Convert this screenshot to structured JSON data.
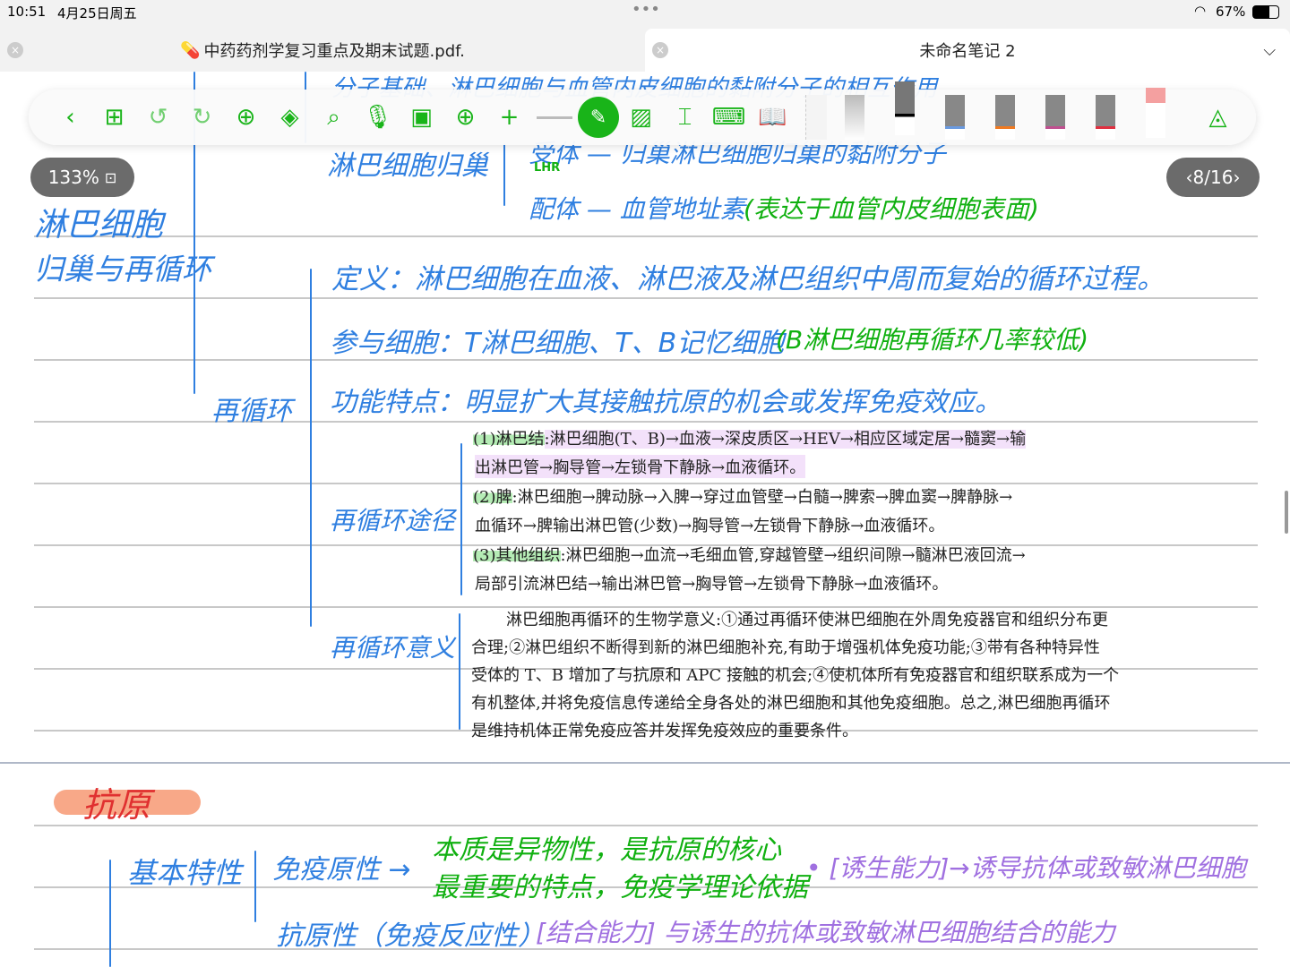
{
  "status": {
    "time": "10:51",
    "date": "4月25日周五",
    "battery": "67%"
  },
  "tabs": [
    {
      "title": "中药药剂学复习重点及期末试题.pdf.",
      "active": false
    },
    {
      "title": "未命名笔记 2",
      "active": true
    }
  ],
  "toolbar": {
    "icons": [
      "back-icon",
      "grid-icon",
      "undo-icon",
      "redo-icon",
      "add-page-icon",
      "layers-icon",
      "search-icon",
      "microphone-icon",
      "media-icon",
      "globe-icon",
      "plus-icon",
      "pen-icon",
      "image-icon",
      "text-box-icon",
      "keyboard-icon",
      "book-icon"
    ],
    "active_color": "#19b419"
  },
  "zoom": "133%",
  "page_indicator": "8/16",
  "notes": {
    "top_cut": "分子基础、淋巴细胞与血管内皮细胞的黏附分子的相互作用",
    "homing": "淋巴细胞归巢",
    "receptor": "受体 — 归巢淋巴细胞归巢的黏附分子",
    "lhr": "LHR",
    "ligand": "配体 — 血管地址素",
    "ligand_note": "(表达于血管内皮细胞表面)",
    "main_title_1": "淋巴细胞",
    "main_title_2": "归巢与再循环",
    "recirc": "再循环",
    "definition": "定义：淋巴细胞在血液、淋巴液及淋巴组织中周而复始的循环过程。",
    "cells": "参与细胞：T淋巴细胞、T、B记忆细胞",
    "cells_note": "(B淋巴细胞再循环几率较低)",
    "function": "功能特点：明显扩大其接触抗原的机会或发挥免疫效应。",
    "pathway": "再循环途径",
    "significance": "再循环意义",
    "antigen": "抗原",
    "basic": "基本特性",
    "immunogenicity": "免疫原性 →",
    "imm_note1": "本质是异物性，是抗原的核心",
    "imm_note2": "最重要的特点，免疫学理论依据",
    "induce": "• [诱生能力]→诱导抗体或致敏淋巴细胞",
    "antigenicity": "抗原性（免疫反应性）",
    "binding": "[结合能力] 与诱生的抗体或致敏淋巴细胞结合的能力"
  },
  "printed": {
    "p1a": "(1)淋巴结",
    "p1b": ":淋巴细胞(T、B)→血液→深皮质区→HEV→相应区域定居→髓窦→输",
    "p1c": "出淋巴管→胸导管→左锁骨下静脉→血液循环。",
    "p2a": "(2)脾",
    "p2b": ":淋巴细胞→脾动脉→入脾→穿过血管壁→白髓→脾索→脾血窦→脾静脉→",
    "p2c": "血循环→脾输出淋巴管(少数)→胸导管→左锁骨下静脉→血液循环。",
    "p3a": "(3)其他组织",
    "p3b": ":淋巴细胞→血流→毛细血管,穿越管壁→组织间隙→髓淋巴液回流→",
    "p3c": "局部引流淋巴结→输出淋巴管→胸导管→左锁骨下静脉→血液循环。",
    "s1": "淋巴细胞再循环的生物学意义:①通过再循环使淋巴细胞在外周免疫器官和组织分布更",
    "s2": "合理;②淋巴组织不断得到新的淋巴细胞补充,有助于增强机体免疫功能;③带有各种特异性",
    "s3": "受体的 T、B 增加了与抗原和 APC 接触的机会;④使机体所有免疫器官和组织联系成为一个",
    "s4": "有机整体,并将免疫信息传递给全身各处的淋巴细胞和其他免疫细胞。总之,淋巴细胞再循环",
    "s5": "是维持机体正常免疫应答并发挥免疫效应的重要条件。"
  }
}
